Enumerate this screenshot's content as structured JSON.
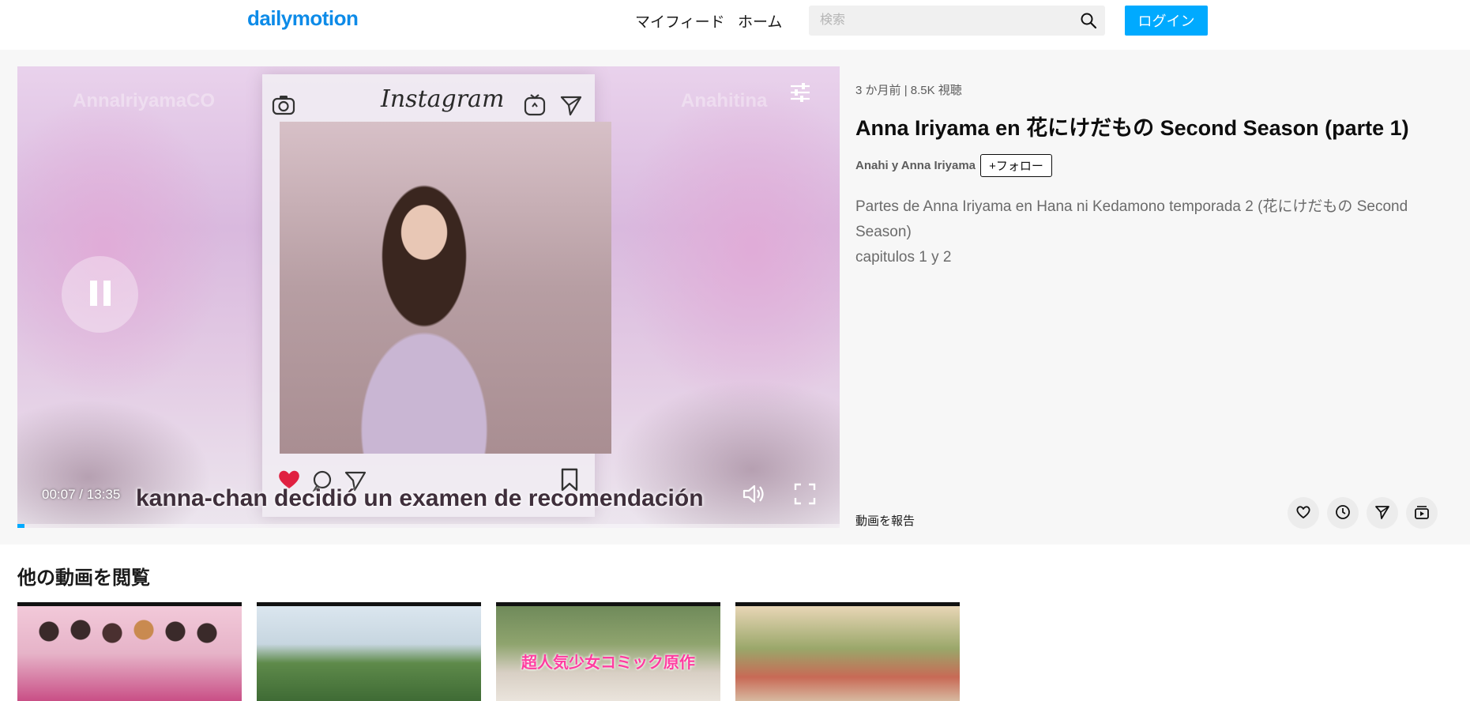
{
  "header": {
    "logo": "dailymotion",
    "nav": [
      {
        "label": "マイフィード"
      },
      {
        "label": "ホーム"
      }
    ],
    "search_placeholder": "検索",
    "login_label": "ログイン"
  },
  "player": {
    "watermark_left": "AnnaIriyamaCO",
    "watermark_right": "Anahitina",
    "overlay_brand": "Instagram",
    "subtitle": "kanna-chan decidió un examen de recomendación",
    "current_time": "00:07",
    "duration": "13:35",
    "time_separator": "/",
    "progress_fraction": 0.009
  },
  "video": {
    "age": "3 か月前",
    "separator": "|",
    "views": "8.5K 視聴",
    "title": "Anna Iriyama en 花にけだもの Second Season (parte 1)",
    "channel": "Anahi y Anna Iriyama",
    "follow_label": "+フォロー",
    "description_line1": "Partes de Anna Iriyama en Hana ni Kedamono temporada 2 (花にけだもの Second Season)",
    "description_line2": "capitulos 1 y 2",
    "report_label": "動画を報告",
    "actions": [
      "heart-icon",
      "clock-icon",
      "share-icon",
      "playlist-icon"
    ]
  },
  "more": {
    "heading": "他の動画を閲覧",
    "thumbnails": [
      {
        "caption": ""
      },
      {
        "caption": ""
      },
      {
        "caption": "超人気少女コミック原作"
      },
      {
        "caption": ""
      }
    ]
  },
  "colors": {
    "brand": "#0d8be8",
    "accent": "#00aaff"
  }
}
